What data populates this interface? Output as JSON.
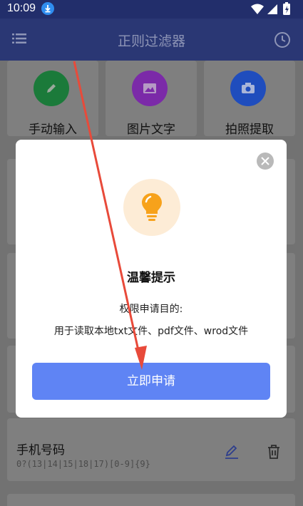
{
  "status_bar": {
    "time": "10:09"
  },
  "app_bar": {
    "title": "正则过滤器"
  },
  "quick_actions": [
    {
      "label": "手动输入",
      "icon": "pencil-icon",
      "color": "#1b7a3a"
    },
    {
      "label": "图片文字",
      "icon": "image-icon",
      "color": "#7b2aa8"
    },
    {
      "label": "拍照提取",
      "icon": "camera-icon",
      "color": "#1f4dbd"
    }
  ],
  "filter_item": {
    "name": "手机号码",
    "pattern": "0?(13|14|15|18|17)[0-9]{9}"
  },
  "dialog": {
    "title": "温馨提示",
    "subtitle": "权限申请目的:",
    "body": "用于读取本地txt文件、pdf文件、wrod文件",
    "apply_label": "立即申请"
  },
  "colors": {
    "app_bar": "#2a3774",
    "primary_button": "#5f84f4",
    "bulb": "#f7a21b",
    "annotation": "#e84a3a"
  }
}
